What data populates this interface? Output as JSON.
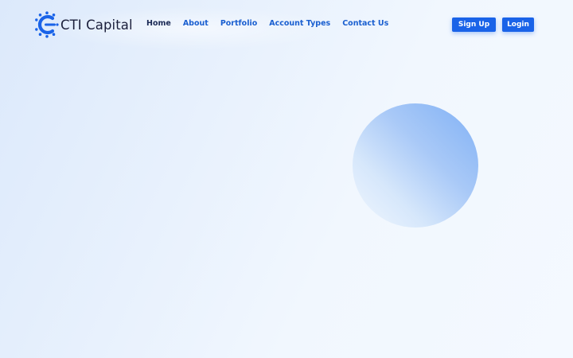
{
  "brand": {
    "name": "CTI Capital",
    "logo_icon": "cti-logo-icon",
    "color": "#1a63e8"
  },
  "nav": {
    "items": [
      {
        "label": "Home",
        "active": true
      },
      {
        "label": "About",
        "active": false
      },
      {
        "label": "Portfolio",
        "active": false
      },
      {
        "label": "Account Types",
        "active": false
      },
      {
        "label": "Contact Us",
        "active": false
      }
    ]
  },
  "actions": {
    "signup_label": "Sign Up",
    "login_label": "Login"
  },
  "colors": {
    "accent": "#1a63e8",
    "nav_link": "#1a5fd0",
    "nav_active": "#1b2a55",
    "brand_text": "#1b1f3b"
  }
}
